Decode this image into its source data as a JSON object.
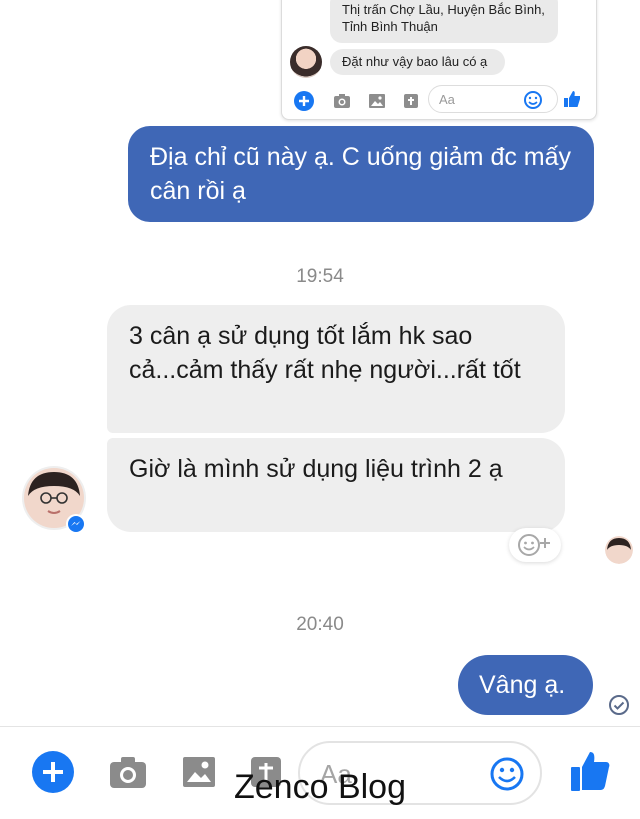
{
  "quoted_screenshot": {
    "address_text": "Thị trấn Chợ Lầu, Huyện Bắc Bình, Tỉnh Bình Thuận",
    "question_text": "Đặt như vậy bao lâu có ạ",
    "input_placeholder": "Aa"
  },
  "messages": {
    "outgoing_1": "Địa chỉ cũ này ạ.  C uống giảm đc mấy cân rồi ạ",
    "time_1": "19:54",
    "incoming_1": "3 cân ạ sử dụng tốt lắm hk sao cả...cảm thấy rất nhẹ người...rất tốt",
    "incoming_2": "Giờ là mình sử dụng liệu trình 2 ạ",
    "time_2": "20:40",
    "outgoing_2": "Vâng ạ."
  },
  "composer": {
    "placeholder": "Aa"
  },
  "watermark": "Zenco Blog",
  "colors": {
    "accent": "#1877f2",
    "outgoing_bubble": "#3f67b6",
    "incoming_bubble": "#eeeeee"
  }
}
